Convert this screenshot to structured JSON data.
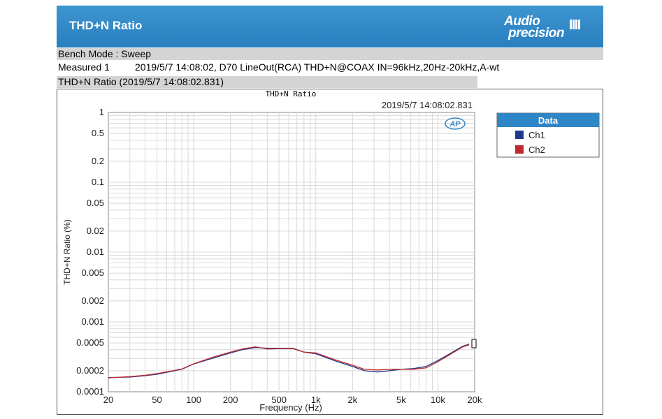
{
  "header": {
    "title": "THD+N Ratio",
    "logo_line1": "Audio",
    "logo_line2": "precision"
  },
  "info": {
    "bench_mode": "Bench Mode : Sweep",
    "measured_label": "Measured 1",
    "measured_desc": "2019/5/7 14:08:02, D70 LineOut(RCA) THD+N@COAX IN=96kHz,20Hz-20kHz,A-wt",
    "plot_heading": "THD+N Ratio (2019/5/7 14:08:02.831)"
  },
  "colors": {
    "header_bg": "#2f86c6",
    "ch1": "#1f3a8a",
    "ch2": "#c0282d",
    "legend_header": "#2f86c6"
  },
  "chart_data": {
    "type": "line",
    "title": "THD+N Ratio",
    "timestamp": "2019/5/7 14:08:02.831",
    "xlabel": "Frequency (Hz)",
    "ylabel": "THD+N Ratio (%)",
    "xscale": "log",
    "yscale": "log",
    "xlim": [
      20,
      20000
    ],
    "ylim": [
      0.0001,
      1
    ],
    "grid": true,
    "legend_title": "Data",
    "legend_position": "right",
    "x_ticks": [
      {
        "v": 20,
        "label": "20"
      },
      {
        "v": 50,
        "label": "50"
      },
      {
        "v": 100,
        "label": "100"
      },
      {
        "v": 200,
        "label": "200"
      },
      {
        "v": 500,
        "label": "500"
      },
      {
        "v": 1000,
        "label": "1k"
      },
      {
        "v": 2000,
        "label": "2k"
      },
      {
        "v": 5000,
        "label": "5k"
      },
      {
        "v": 10000,
        "label": "10k"
      },
      {
        "v": 20000,
        "label": "20k"
      }
    ],
    "y_ticks": [
      {
        "v": 1,
        "label": "1"
      },
      {
        "v": 0.5,
        "label": "0.5"
      },
      {
        "v": 0.2,
        "label": "0.2"
      },
      {
        "v": 0.1,
        "label": "0.1"
      },
      {
        "v": 0.05,
        "label": "0.05"
      },
      {
        "v": 0.02,
        "label": "0.02"
      },
      {
        "v": 0.01,
        "label": "0.01"
      },
      {
        "v": 0.005,
        "label": "0.005"
      },
      {
        "v": 0.002,
        "label": "0.002"
      },
      {
        "v": 0.001,
        "label": "0.001"
      },
      {
        "v": 0.0005,
        "label": "0.0005"
      },
      {
        "v": 0.0002,
        "label": "0.0002"
      },
      {
        "v": 0.0001,
        "label": "0.0001"
      }
    ],
    "series": [
      {
        "name": "Ch1",
        "color": "#1f3a8a",
        "points": [
          [
            20,
            0.00016
          ],
          [
            30,
            0.000162
          ],
          [
            40,
            0.00017
          ],
          [
            50,
            0.000178
          ],
          [
            80,
            0.00021
          ],
          [
            100,
            0.00025
          ],
          [
            150,
            0.00031
          ],
          [
            200,
            0.00036
          ],
          [
            250,
            0.0004
          ],
          [
            320,
            0.00043
          ],
          [
            400,
            0.00042
          ],
          [
            500,
            0.00042
          ],
          [
            650,
            0.00042
          ],
          [
            800,
            0.00037
          ],
          [
            1000,
            0.00035
          ],
          [
            1500,
            0.00027
          ],
          [
            2000,
            0.00023
          ],
          [
            2500,
            0.0002
          ],
          [
            3200,
            0.000192
          ],
          [
            4000,
            0.0002
          ],
          [
            5000,
            0.00021
          ],
          [
            6300,
            0.000215
          ],
          [
            8000,
            0.00023
          ],
          [
            10000,
            0.00028
          ],
          [
            12500,
            0.00035
          ],
          [
            16000,
            0.00045
          ],
          [
            18000,
            0.00048
          ]
        ]
      },
      {
        "name": "Ch2",
        "color": "#c0282d",
        "points": [
          [
            20,
            0.000158
          ],
          [
            30,
            0.000165
          ],
          [
            40,
            0.000172
          ],
          [
            50,
            0.000182
          ],
          [
            80,
            0.000212
          ],
          [
            100,
            0.000252
          ],
          [
            150,
            0.00032
          ],
          [
            200,
            0.00037
          ],
          [
            250,
            0.00041
          ],
          [
            320,
            0.00044
          ],
          [
            400,
            0.00041
          ],
          [
            500,
            0.000415
          ],
          [
            650,
            0.000415
          ],
          [
            800,
            0.00037
          ],
          [
            1000,
            0.00036
          ],
          [
            1500,
            0.00028
          ],
          [
            2000,
            0.00024
          ],
          [
            2500,
            0.00021
          ],
          [
            3200,
            0.000205
          ],
          [
            4000,
            0.00021
          ],
          [
            5000,
            0.00021
          ],
          [
            6300,
            0.00021
          ],
          [
            8000,
            0.00022
          ],
          [
            10000,
            0.00027
          ],
          [
            12500,
            0.00034
          ],
          [
            16000,
            0.00044
          ],
          [
            18000,
            0.00047
          ]
        ]
      }
    ]
  }
}
